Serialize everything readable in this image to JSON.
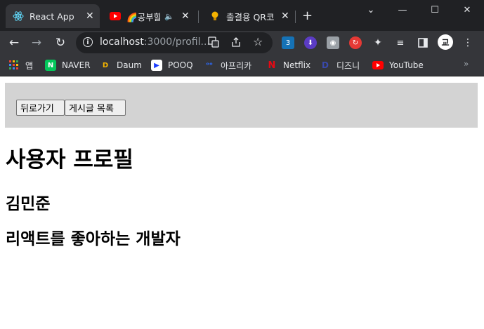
{
  "browser": {
    "tabs": [
      {
        "title": "React App",
        "icon": "react-icon",
        "active": true
      },
      {
        "title": "🌈공부할",
        "icon": "youtube-icon",
        "audio": true
      },
      {
        "title": "출결용 QR코",
        "icon": "lightbulb-icon"
      }
    ],
    "window_controls": {
      "minimize": "—",
      "maximize": "☐",
      "close": "✕",
      "tab_search": "⌄"
    },
    "address_bar": {
      "host": "localhost",
      "rest": ":3000/profil..."
    },
    "bookmarks": [
      {
        "label": "앱",
        "icon": "apps-grid-icon"
      },
      {
        "label": "NAVER",
        "icon": "naver-icon",
        "letter": "N",
        "color": "#03c75a"
      },
      {
        "label": "Daum",
        "icon": "daum-icon",
        "letter": "D",
        "color": "#f4b400"
      },
      {
        "label": "POOQ",
        "icon": "pooq-icon",
        "letter": "▶",
        "color": "#1a3cff"
      },
      {
        "label": "아프리카",
        "icon": "afreeca-icon",
        "letter": "ᵒᵒ",
        "color": "#2c6bff"
      },
      {
        "label": "Netflix",
        "icon": "netflix-icon",
        "letter": "N",
        "color": "#e50914"
      },
      {
        "label": "디즈니",
        "icon": "disney-icon",
        "letter": "D",
        "color": "#1a237e"
      },
      {
        "label": "YouTube",
        "icon": "youtube-icon",
        "letter": "▶",
        "color": "#ff0000"
      }
    ],
    "bookmarks_overflow": "»",
    "profile_initial": "교"
  },
  "page": {
    "buttons": {
      "back": "뒤로가기",
      "post_list": "게시글 목록"
    },
    "title": "사용자 프로필",
    "name": "김민준",
    "bio": "리액트를 좋아하는 개발자"
  }
}
